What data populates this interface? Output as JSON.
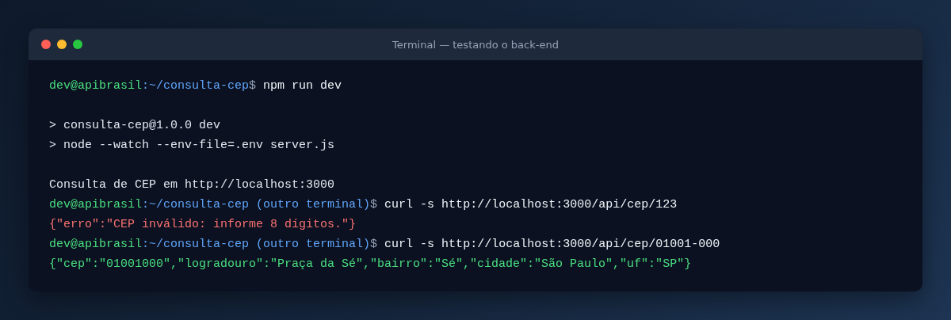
{
  "window": {
    "title": "Terminal — testando o back-end"
  },
  "blocks": [
    {
      "lines": [
        {
          "kind": "prompt",
          "user": "dev@apibrasil",
          "path": ":~/consulta-cep",
          "symbol": "$",
          "command": "npm run dev"
        }
      ]
    },
    {
      "lines": [
        {
          "kind": "output",
          "text": "> consulta-cep@1.0.0 dev"
        },
        {
          "kind": "output",
          "text": "> node --watch --env-file=.env server.js"
        }
      ]
    },
    {
      "lines": [
        {
          "kind": "output",
          "text": "Consulta de CEP em http://localhost:3000"
        },
        {
          "kind": "prompt",
          "user": "dev@apibrasil",
          "path": ":~/consulta-cep (outro terminal)",
          "symbol": "$",
          "command": "curl -s http://localhost:3000/api/cep/123"
        },
        {
          "kind": "error",
          "text": "{\"erro\":\"CEP inválido: informe 8 dígitos.\"}"
        },
        {
          "kind": "prompt",
          "user": "dev@apibrasil",
          "path": ":~/consulta-cep (outro terminal)",
          "symbol": "$",
          "command": "curl -s http://localhost:3000/api/cep/01001-000"
        },
        {
          "kind": "success",
          "text": "{\"cep\":\"01001000\",\"logradouro\":\"Praça da Sé\",\"bairro\":\"Sé\",\"cidade\":\"São Paulo\",\"uf\":\"SP\"}"
        }
      ]
    }
  ]
}
